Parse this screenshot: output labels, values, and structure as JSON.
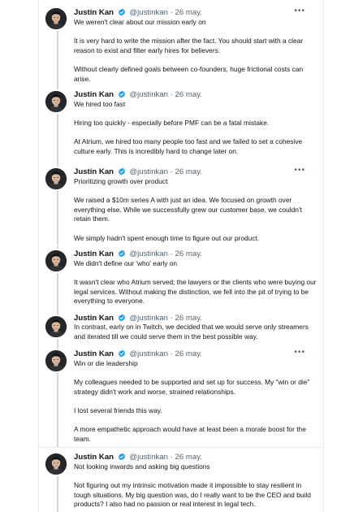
{
  "author": {
    "name": "Justin Kan",
    "handle": "@justinkan",
    "separator": "·",
    "verified_icon": "verified-badge-icon",
    "avatar_icon": "profile-avatar-icon"
  },
  "more_icon": "more-options-icon",
  "colors": {
    "verified": "#1d9bf0",
    "text": "#0f1419",
    "muted": "#536471",
    "divider": "#e6ecf0",
    "thread_line": "#cfd9de"
  },
  "tweets": [
    {
      "date": "26 may.",
      "paragraphs": [
        "We weren't clear about our mission early on",
        "It is very hard to write the mission after the fact. You should start with a clear reason to exist and filter early hires for believers.",
        "Without clearly defined goals between co-founders, huge frictional costs can arise."
      ]
    },
    {
      "date": "26 may.",
      "paragraphs": [
        "We hired too fast",
        "Hiring too quickly - especially before PMF can be a fatal mistake.",
        "At Atrium, we hired too many people too fast and we failed to set a cohesive culture early. This is incredibly hard to change later on."
      ]
    },
    {
      "date": "26 may.",
      "paragraphs": [
        "Prioritizing growth over product",
        "We raised a $10m series A with just an idea. We focused on growth over everything else. While we successfully grew our customer base, we couldn't retain them.",
        "We simply hadn't spent enough time to figure out our product."
      ]
    },
    {
      "date": "26 may.",
      "paragraphs": [
        "We didn't define our 'who' early on",
        "It wasn't clear who Atrium served; the lawyers or the clients who were buying our legal services. Without making the distinction, we fell into the pit of trying to be everything to everyone."
      ]
    },
    {
      "date": "26 may.",
      "paragraphs": [
        "In contrast, early on in Twitch, we decided that we would serve only streamers and iterated till we could serve them in the best possible way."
      ]
    },
    {
      "date": "26 may.",
      "paragraphs": [
        "Win or die leadership",
        "My colleagues needed to be supported and set up for success. My \"win or die\" strategy didn't work and worse, strained relationships.",
        "I lost several friends this way.",
        "A more empathetic approach would have at least been a morale boost for the team."
      ]
    },
    {
      "date": "26 may.",
      "paragraphs": [
        "Not looking inwards and asking big questions",
        "Not figuring out my intrinsic motivation made it impossible to stay resilient in tough situations. My big question was, do I really want to be the CEO and build products? I also had no passion or real interest in legal tech."
      ]
    }
  ]
}
